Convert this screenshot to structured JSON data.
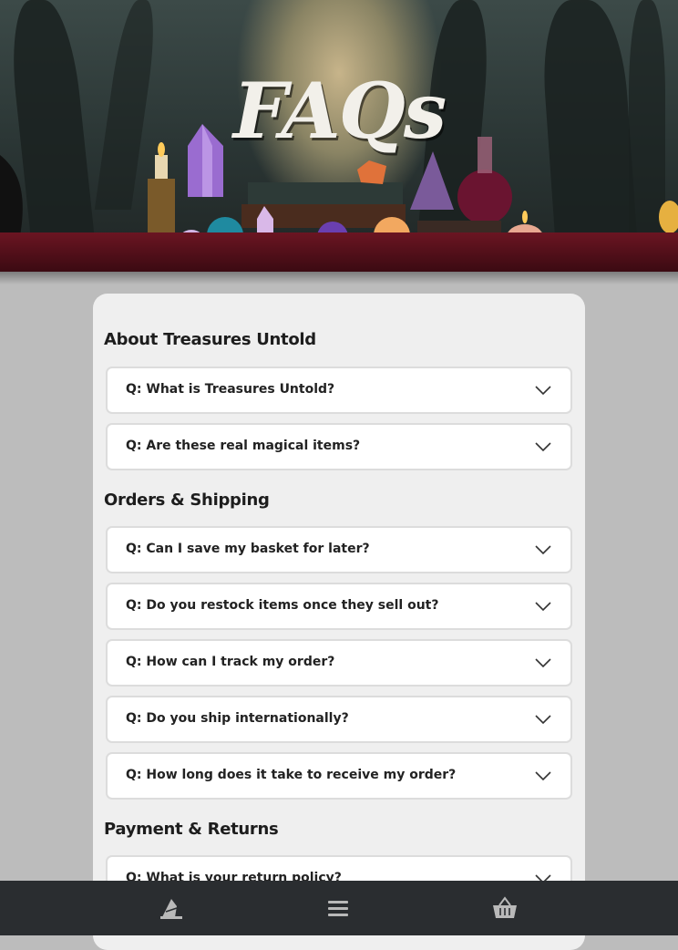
{
  "header": {
    "title": "FAQs"
  },
  "sections": [
    {
      "title": "About Treasures Untold",
      "items": [
        "Q: What is Treasures Untold?",
        "Q: Are these real magical items?"
      ]
    },
    {
      "title": "Orders & Shipping",
      "items": [
        "Q: Can I save my basket for later?",
        "Q: Do you restock items once they sell out?",
        "Q: How can I track my order?",
        "Q: Do you ship internationally?",
        "Q: How long does it take to receive my order?"
      ]
    },
    {
      "title": "Payment & Returns",
      "items": [
        "Q: What is your return policy?"
      ]
    }
  ],
  "bottom_nav": {
    "items": [
      "wizard-hat-icon",
      "menu-icon",
      "basket-icon"
    ]
  },
  "colors": {
    "page_background": "#bcbcbc",
    "card_background": "#efefef",
    "nav_background": "#2a2d30",
    "nav_icon": "#b9b9b9"
  }
}
